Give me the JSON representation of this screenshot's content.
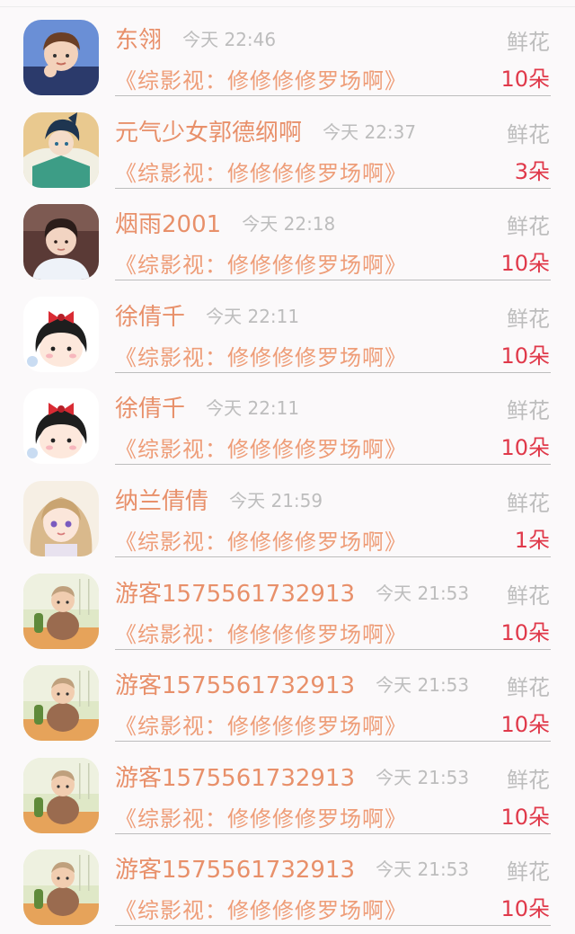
{
  "rows": [
    {
      "name": "东翎",
      "time": "今天 22:46",
      "book": "《综影视：修修修修罗场啊》",
      "gift": "鲜花",
      "count": "10朵",
      "avatar_icon": "boy-avatar-icon"
    },
    {
      "name": "元气少女郭德纲啊",
      "time": "今天 22:37",
      "book": "《综影视：修修修修罗场啊》",
      "gift": "鲜花",
      "count": "3朵",
      "avatar_icon": "anime-warrior-avatar-icon"
    },
    {
      "name": "烟雨2001",
      "time": "今天 22:18",
      "book": "《综影视：修修修修罗场啊》",
      "gift": "鲜花",
      "count": "10朵",
      "avatar_icon": "man-portrait-avatar-icon"
    },
    {
      "name": "徐倩千",
      "time": "今天 22:11",
      "book": "《综影视：修修修修罗场啊》",
      "gift": "鲜花",
      "count": "10朵",
      "avatar_icon": "cartoon-girl-avatar-icon"
    },
    {
      "name": "徐倩千",
      "time": "今天 22:11",
      "book": "《综影视：修修修修罗场啊》",
      "gift": "鲜花",
      "count": "10朵",
      "avatar_icon": "cartoon-girl-avatar-icon"
    },
    {
      "name": "纳兰倩倩",
      "time": "今天 21:59",
      "book": "《综影视：修修修修罗场啊》",
      "gift": "鲜花",
      "count": "1朵",
      "avatar_icon": "anime-girl-avatar-icon"
    },
    {
      "name": "游客1575561732913",
      "time": "今天 21:53",
      "book": "《综影视：修修修修罗场啊》",
      "gift": "鲜花",
      "count": "10朵",
      "avatar_icon": "baby-avatar-icon"
    },
    {
      "name": "游客1575561732913",
      "time": "今天 21:53",
      "book": "《综影视：修修修修罗场啊》",
      "gift": "鲜花",
      "count": "10朵",
      "avatar_icon": "baby-avatar-icon"
    },
    {
      "name": "游客1575561732913",
      "time": "今天 21:53",
      "book": "《综影视：修修修修罗场啊》",
      "gift": "鲜花",
      "count": "10朵",
      "avatar_icon": "baby-avatar-icon"
    },
    {
      "name": "游客1575561732913",
      "time": "今天 21:53",
      "book": "《综影视：修修修修罗场啊》",
      "gift": "鲜花",
      "count": "10朵",
      "avatar_icon": "baby-avatar-icon"
    }
  ],
  "colors": {
    "name": "#e8906a",
    "book": "#ee9d78",
    "count": "#e0394a",
    "muted": "#bdbdbd",
    "background": "#fbf9fa"
  }
}
